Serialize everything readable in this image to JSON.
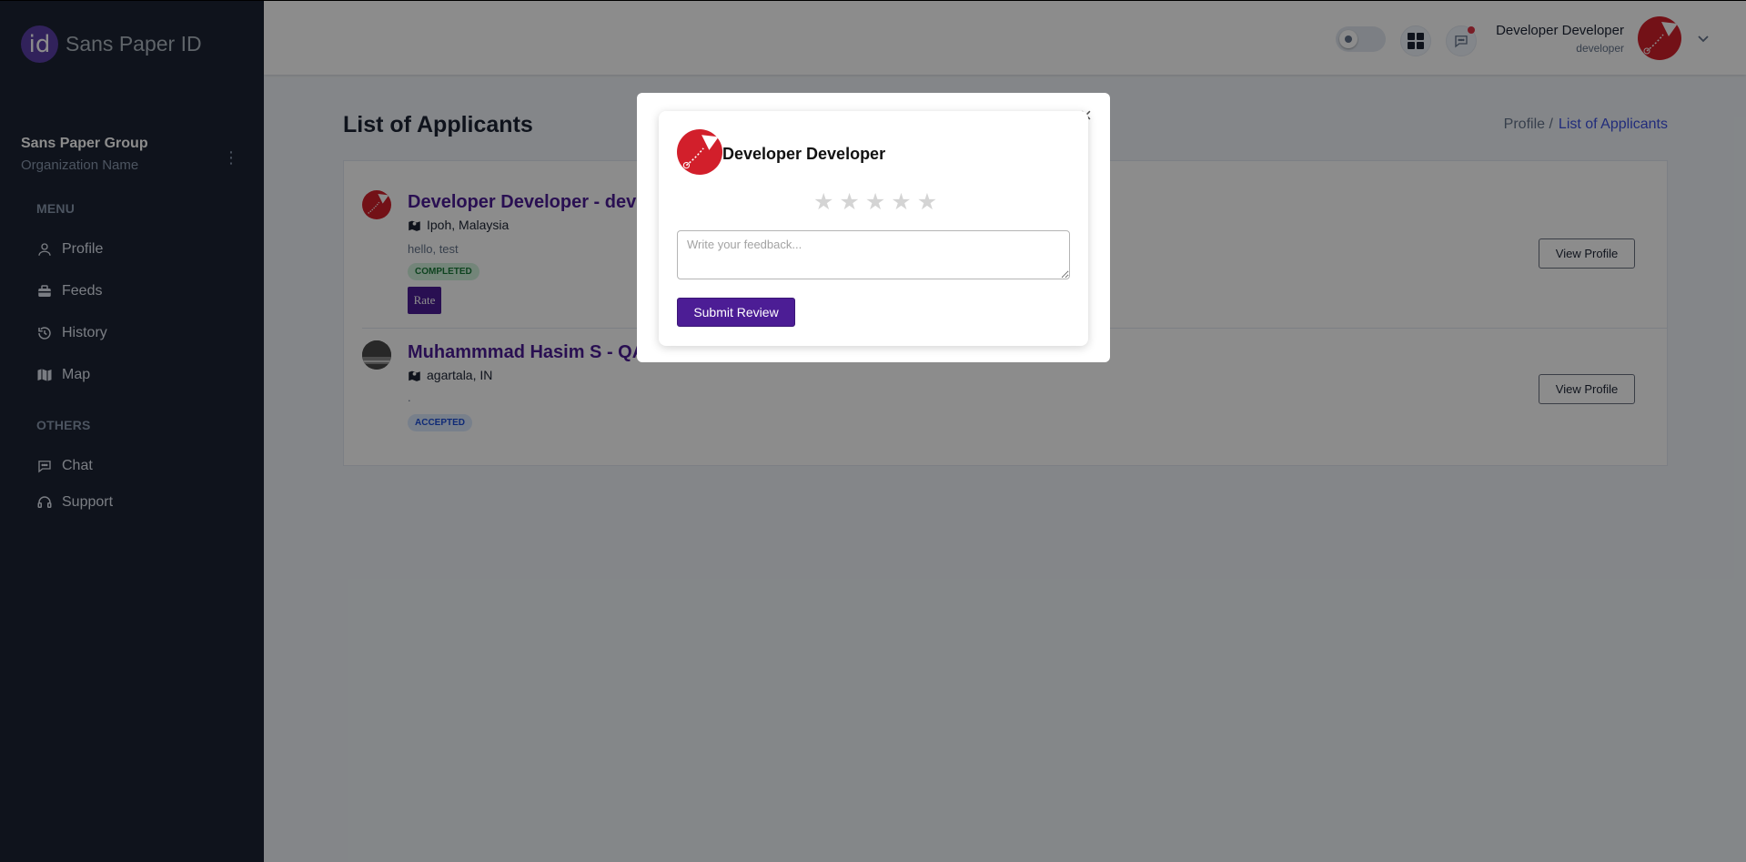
{
  "brand": {
    "logo_text": "id",
    "name": "Sans Paper ID"
  },
  "organization": {
    "name": "Sans Paper Group",
    "label": "Organization Name"
  },
  "sidebar": {
    "menu_title": "MENU",
    "menu_items": [
      {
        "label": "Profile",
        "icon": "user-icon"
      },
      {
        "label": "Feeds",
        "icon": "briefcase-icon"
      },
      {
        "label": "History",
        "icon": "history-icon"
      },
      {
        "label": "Map",
        "icon": "map-icon"
      }
    ],
    "others_title": "OTHERS",
    "other_items": [
      {
        "label": "Chat",
        "icon": "chat-icon"
      },
      {
        "label": "Support",
        "icon": "headset-icon"
      }
    ]
  },
  "header": {
    "user_name": "Developer Developer",
    "user_role": "developer",
    "notification_dot": true
  },
  "page": {
    "title": "List of Applicants",
    "breadcrumb_parent": "Profile /",
    "breadcrumb_current": "List of Applicants"
  },
  "applicants": [
    {
      "title": "Developer Developer - dev",
      "location": "Ipoh, Malaysia",
      "message": "hello, test",
      "status": "COMPLETED",
      "rate_label": "Rate",
      "view_label": "View Profile"
    },
    {
      "title": "Muhammmad Hasim S - QA",
      "location": "agartala, IN",
      "message": ".",
      "status": "ACCEPTED",
      "view_label": "View Profile"
    }
  ],
  "modal": {
    "close": "×",
    "name": "Developer Developer",
    "rating": 0,
    "rating_max": 5,
    "feedback_placeholder": "Write your feedback...",
    "submit_label": "Submit Review"
  },
  "colors": {
    "sidebar_bg": "#1c2434",
    "accent": "#4c1d95",
    "link": "#3c50e0",
    "avatar_red": "#d21f2b"
  }
}
